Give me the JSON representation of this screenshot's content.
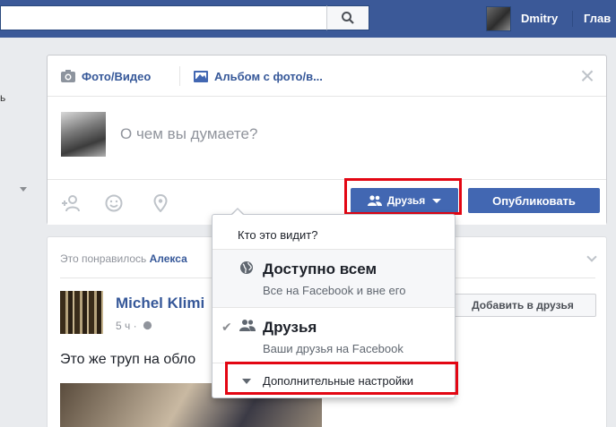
{
  "topbar": {
    "user_name": "Dmitry",
    "home_label": "Глав",
    "bg_color": "#3b5998"
  },
  "sidebar": {
    "fragment_text": "ь"
  },
  "composer": {
    "tabs": [
      {
        "label": "Фото/Видео",
        "icon": "camera-icon"
      },
      {
        "label": "Альбом с фото/в...",
        "icon": "photo-album-icon"
      }
    ],
    "placeholder": "О чем вы думаете?",
    "audience_button": "Друзья",
    "publish_button": "Опубликовать"
  },
  "feed": {
    "liked_prefix": "Это понравилось ",
    "liked_name": "Алекса",
    "author": "Michel Klimi",
    "time": "5 ч ·",
    "add_friend": "Добавить в друзья",
    "post_text": "Это же труп на обло"
  },
  "audience_menu": {
    "header": "Кто это видит?",
    "options": [
      {
        "title": "Доступно всем",
        "subtitle": "Все на Facebook и вне его",
        "icon": "globe-icon",
        "selected": false
      },
      {
        "title": "Друзья",
        "subtitle": "Ваши друзья на Facebook",
        "icon": "friends-icon",
        "selected": true
      }
    ],
    "more_settings": "Дополнительные настройки"
  },
  "colors": {
    "accent": "#4267b2",
    "link": "#365899",
    "highlight": "#e30613"
  }
}
